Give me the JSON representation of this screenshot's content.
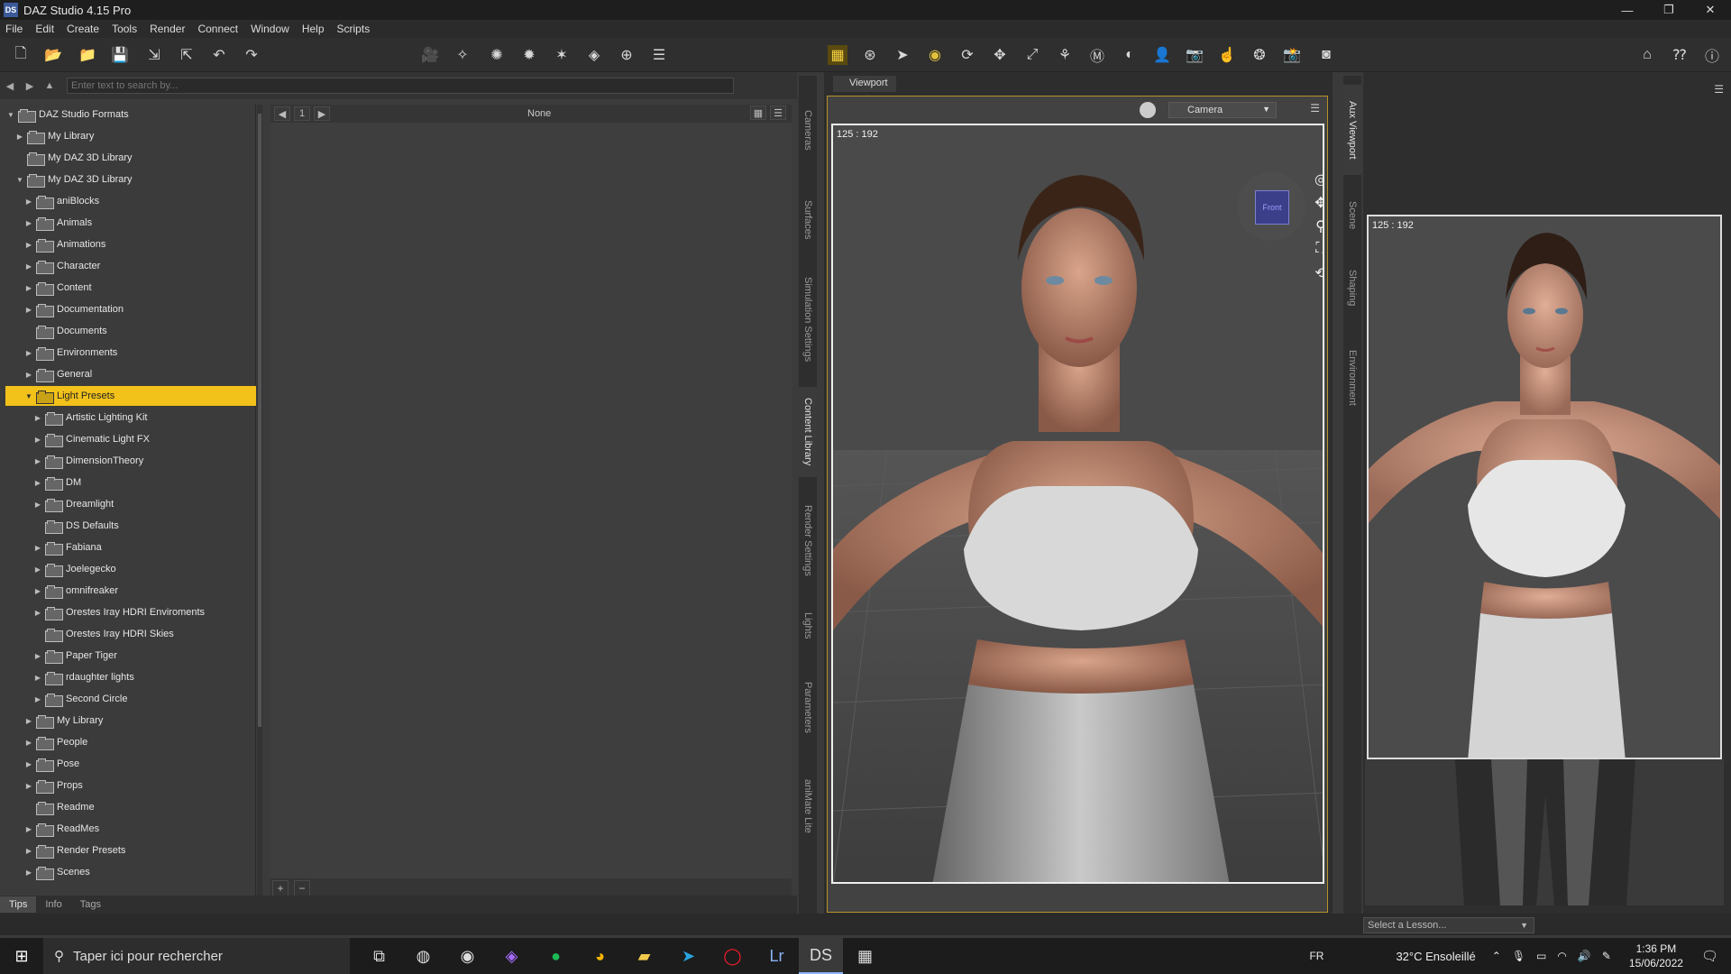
{
  "window": {
    "title": "DAZ Studio 4.15 Pro",
    "app_icon": "DS"
  },
  "menu": [
    "File",
    "Edit",
    "Create",
    "Tools",
    "Render",
    "Connect",
    "Window",
    "Help",
    "Scripts"
  ],
  "search": {
    "placeholder": "Enter text to search by..."
  },
  "tree": [
    {
      "label": "DAZ Studio Formats",
      "level": 0,
      "expanded": true
    },
    {
      "label": "My Library",
      "level": 1,
      "expanded": false
    },
    {
      "label": "My DAZ 3D Library",
      "level": 1,
      "leaf": true
    },
    {
      "label": "My DAZ 3D Library",
      "level": 1,
      "expanded": true
    },
    {
      "label": "aniBlocks",
      "level": 2
    },
    {
      "label": "Animals",
      "level": 2
    },
    {
      "label": "Animations",
      "level": 2
    },
    {
      "label": "Character",
      "level": 2
    },
    {
      "label": "Content",
      "level": 2
    },
    {
      "label": "Documentation",
      "level": 2
    },
    {
      "label": "Documents",
      "level": 2,
      "leaf": true
    },
    {
      "label": "Environments",
      "level": 2
    },
    {
      "label": "General",
      "level": 2
    },
    {
      "label": "Light Presets",
      "level": 2,
      "expanded": true,
      "selected": true
    },
    {
      "label": "Artistic Lighting Kit",
      "level": 3
    },
    {
      "label": "Cinematic Light FX",
      "level": 3
    },
    {
      "label": "DimensionTheory",
      "level": 3
    },
    {
      "label": "DM",
      "level": 3
    },
    {
      "label": "Dreamlight",
      "level": 3
    },
    {
      "label": "DS Defaults",
      "level": 3,
      "leaf": true
    },
    {
      "label": "Fabiana",
      "level": 3
    },
    {
      "label": "Joelegecko",
      "level": 3
    },
    {
      "label": "omnifreaker",
      "level": 3
    },
    {
      "label": "Orestes Iray HDRI Enviroments",
      "level": 3
    },
    {
      "label": "Orestes Iray HDRI Skies",
      "level": 3,
      "leaf": true
    },
    {
      "label": "Paper Tiger",
      "level": 3
    },
    {
      "label": "rdaughter lights",
      "level": 3
    },
    {
      "label": "Second Circle",
      "level": 3
    },
    {
      "label": "My Library",
      "level": 2
    },
    {
      "label": "People",
      "level": 2
    },
    {
      "label": "Pose",
      "level": 2
    },
    {
      "label": "Props",
      "level": 2
    },
    {
      "label": "Readme",
      "level": 2,
      "leaf": true
    },
    {
      "label": "ReadMes",
      "level": 2
    },
    {
      "label": "Render Presets",
      "level": 2
    },
    {
      "label": "Scenes",
      "level": 2
    }
  ],
  "pager": {
    "page": "1",
    "filter": "None"
  },
  "bottom_tabs": [
    "Tips",
    "Info",
    "Tags"
  ],
  "side_tabs": [
    "Cameras",
    "Surfaces",
    "Simulation Settings",
    "Content Library",
    "Render Settings",
    "Lights",
    "Parameters",
    "aniMate Lite"
  ],
  "viewport": {
    "tab": "Viewport",
    "camera": "Camera",
    "coords": "125 : 192",
    "cube_face": "Front"
  },
  "aux_tabs": [
    "Aux Viewport",
    "Scene",
    "Shaping",
    "Environment"
  ],
  "aux": {
    "coords": "125 : 192"
  },
  "lesson": {
    "placeholder": "Select a Lesson..."
  },
  "taskbar": {
    "search_placeholder": "Taper ici pour rechercher",
    "lang": "FR",
    "weather": "32°C  Ensoleillé",
    "time": "1:36 PM",
    "date": "15/06/2022"
  }
}
